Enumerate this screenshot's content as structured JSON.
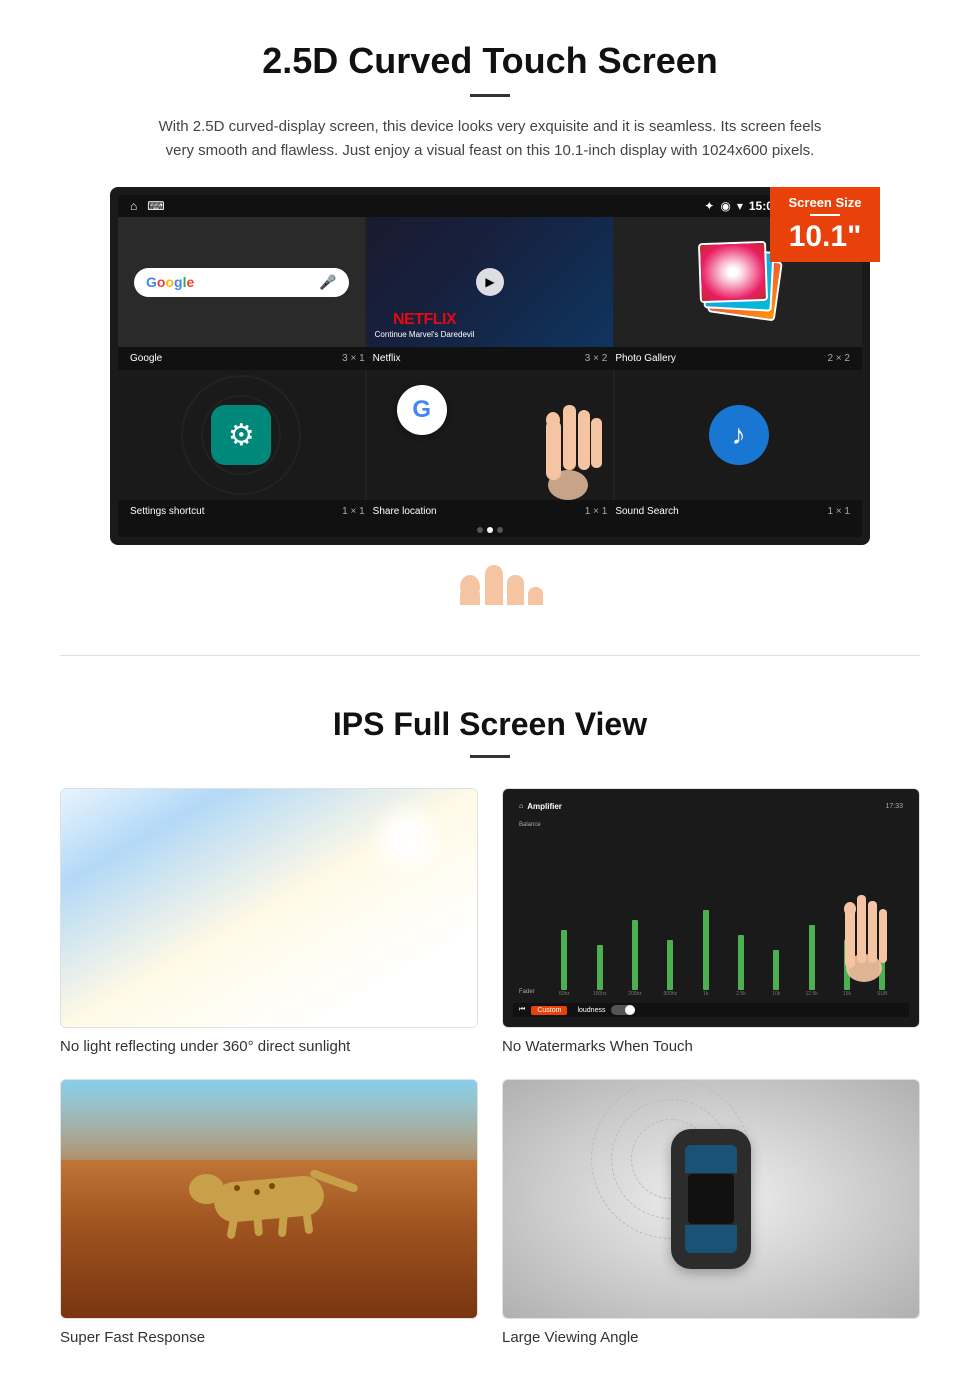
{
  "section1": {
    "title": "2.5D Curved Touch Screen",
    "description": "With 2.5D curved-display screen, this device looks very exquisite and it is seamless. Its screen feels very smooth and flawless. Just enjoy a visual feast on this 10.1-inch display with 1024x600 pixels.",
    "badge": {
      "label": "Screen Size",
      "size": "10.1\""
    },
    "statusBar": {
      "time": "15:06"
    },
    "apps": [
      {
        "name": "Google",
        "size": "3 × 1"
      },
      {
        "name": "Netflix",
        "size": "3 × 2"
      },
      {
        "name": "Photo Gallery",
        "size": "2 × 2"
      },
      {
        "name": "Settings shortcut",
        "size": "1 × 1"
      },
      {
        "name": "Share location",
        "size": "1 × 1"
      },
      {
        "name": "Sound Search",
        "size": "1 × 1"
      }
    ],
    "netflix": {
      "logo": "NETFLIX",
      "sub": "Continue Marvel's Daredevil"
    }
  },
  "section2": {
    "title": "IPS Full Screen View",
    "features": [
      {
        "label": "No light reflecting under 360° direct sunlight",
        "image_type": "sunlight"
      },
      {
        "label": "No Watermarks When Touch",
        "image_type": "amplifier"
      },
      {
        "label": "Super Fast Response",
        "image_type": "cheetah"
      },
      {
        "label": "Large Viewing Angle",
        "image_type": "car_top"
      }
    ]
  }
}
